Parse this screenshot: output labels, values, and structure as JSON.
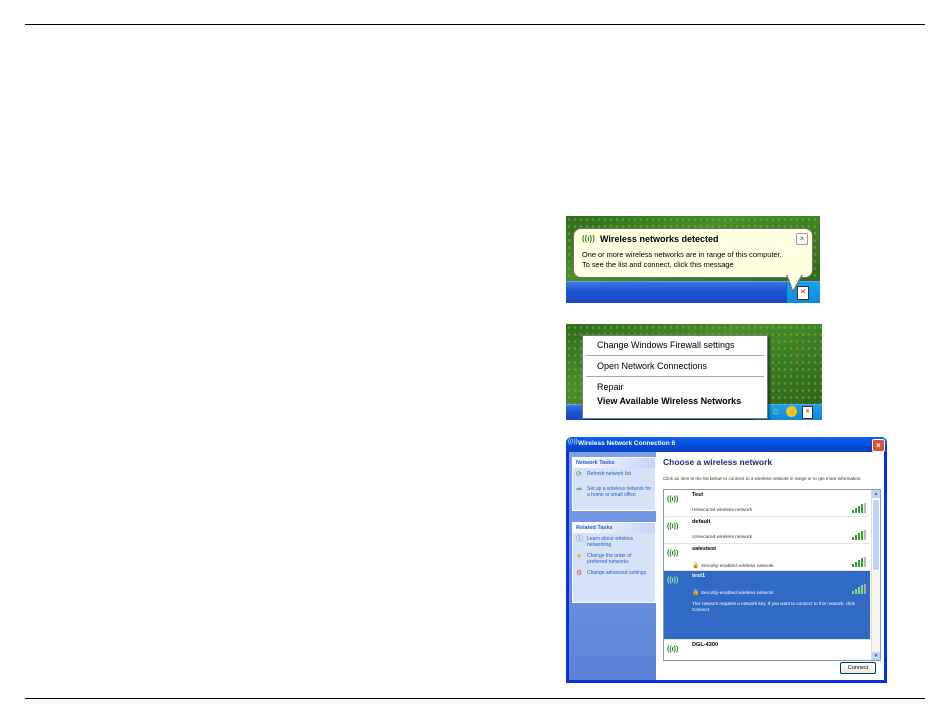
{
  "balloon": {
    "title": "Wireless networks detected",
    "line1": "One or more wireless networks are in range of this computer.",
    "line2": "To see the list and connect, click this message",
    "close_glyph": "×",
    "wireless_icon": "wireless-signal-icon"
  },
  "context_menu": {
    "items": [
      "Change Windows Firewall settings",
      "Open Network Connections",
      "Repair",
      "View Available Wireless Networks"
    ]
  },
  "dialog": {
    "title": "Wireless Network Connection 6",
    "close_glyph": "×",
    "network_tasks": {
      "header": "Network Tasks",
      "items": [
        "Refresh network list",
        "Set up a wireless network for a home or small office"
      ]
    },
    "related_tasks": {
      "header": "Related Tasks",
      "items": [
        "Learn about wireless networking",
        "Change the order of preferred networks",
        "Change advanced settings"
      ]
    },
    "heading": "Choose a wireless network",
    "description": "Click an item in the list below to connect to a wireless network in range or to get more information.",
    "networks": [
      {
        "name": "Test",
        "status": "Unsecured wireless network",
        "signal": 4,
        "secured": false
      },
      {
        "name": "default",
        "status": "Unsecured wireless network",
        "signal": 4,
        "secured": false
      },
      {
        "name": "salestest",
        "status": "Security-enabled wireless network",
        "signal": 4,
        "secured": true
      },
      {
        "name": "test1",
        "status": "Security-enabled wireless network",
        "signal": 4,
        "secured": true,
        "selected": true,
        "note": "This network requires a network key. If you want to connect to this network, click Connect."
      },
      {
        "name": "DGL-4300",
        "status": "",
        "signal": 4,
        "secured": false
      }
    ],
    "connect_label": "Connect"
  },
  "colors": {
    "balloon_bg": "#ffffe1",
    "taskbar_blue": "#1c55d2",
    "selection_blue": "#316ac5",
    "xp_title_blue": "#0548d4"
  }
}
